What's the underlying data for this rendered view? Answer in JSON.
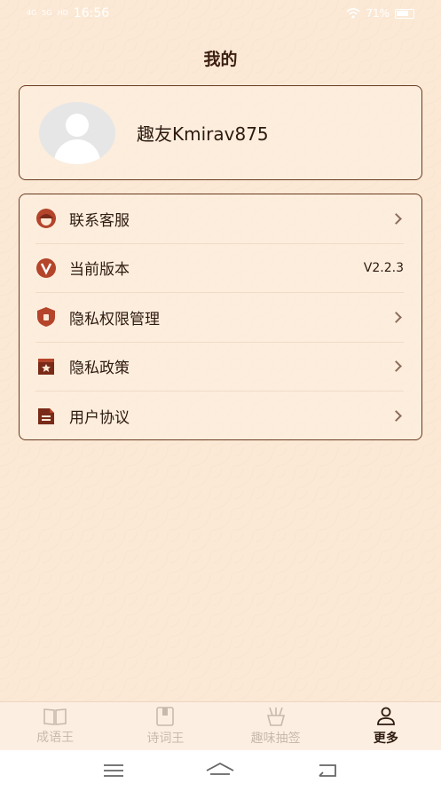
{
  "status_bar": {
    "time": "16:56",
    "signal1": "4G",
    "signal2": "5G",
    "hd": "HD",
    "battery": "71%"
  },
  "page": {
    "title": "我的"
  },
  "profile": {
    "username": "趣友Kmirav875"
  },
  "menu": {
    "items": [
      {
        "label": "联系客服",
        "icon": "customer-service-icon",
        "value": ""
      },
      {
        "label": "当前版本",
        "icon": "version-icon",
        "value": "V2.2.3"
      },
      {
        "label": "隐私权限管理",
        "icon": "shield-icon",
        "value": ""
      },
      {
        "label": "隐私政策",
        "icon": "star-bookmark-icon",
        "value": ""
      },
      {
        "label": "用户协议",
        "icon": "document-icon",
        "value": ""
      }
    ]
  },
  "bottom_nav": {
    "tabs": [
      {
        "label": "成语王",
        "icon": "book-icon",
        "active": false
      },
      {
        "label": "诗词王",
        "icon": "notebook-icon",
        "active": false
      },
      {
        "label": "趣味抽签",
        "icon": "fortune-sticks-icon",
        "active": false
      },
      {
        "label": "更多",
        "icon": "person-icon",
        "active": true
      }
    ]
  },
  "colors": {
    "accent": "#b4442a",
    "background": "#fbe9d6",
    "border": "#6b3a1f"
  }
}
